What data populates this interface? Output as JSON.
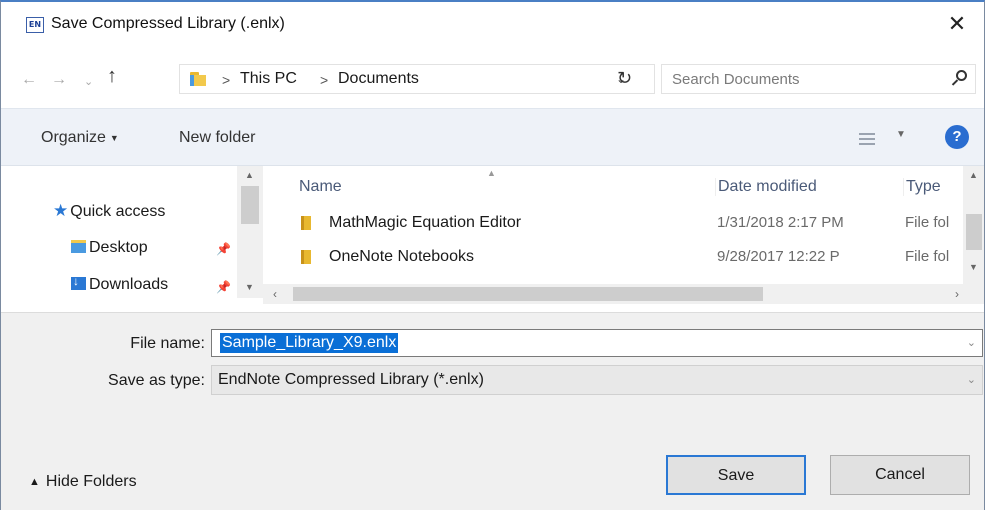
{
  "window": {
    "app_icon_text": "EN",
    "title": "Save Compressed Library (.enlx)",
    "close_symbol": "✕"
  },
  "address_bar": {
    "breadcrumbs": [
      "This PC",
      "Documents"
    ],
    "search_placeholder": "Search Documents"
  },
  "toolbar": {
    "organize_label": "Organize",
    "new_folder_label": "New folder",
    "help_symbol": "?"
  },
  "nav_pane": {
    "items": [
      {
        "label": "Quick access",
        "icon": "star-icon"
      },
      {
        "label": "Desktop",
        "icon": "desktop-folder-icon",
        "pinned": true
      },
      {
        "label": "Downloads",
        "icon": "downloads-folder-icon",
        "pinned": true
      }
    ]
  },
  "file_list": {
    "columns": [
      "Name",
      "Date modified",
      "Type"
    ],
    "rows": [
      {
        "name": "MathMagic Equation Editor",
        "date": "1/31/2018 2:17 PM",
        "type": "File fol"
      },
      {
        "name": "OneNote Notebooks",
        "date": "9/28/2017 12:22 P",
        "type": "File fol"
      }
    ]
  },
  "form": {
    "file_name_label": "File name:",
    "file_name_value": "Sample_Library_X9.enlx",
    "save_type_label": "Save as type:",
    "save_type_value": "EndNote Compressed Library (*.enlx)"
  },
  "footer": {
    "hide_folders_label": "Hide Folders",
    "save_label": "Save",
    "cancel_label": "Cancel"
  },
  "colors": {
    "accent": "#2a78d4",
    "selection": "#0a6fd6",
    "folder": "#f2c94c"
  }
}
